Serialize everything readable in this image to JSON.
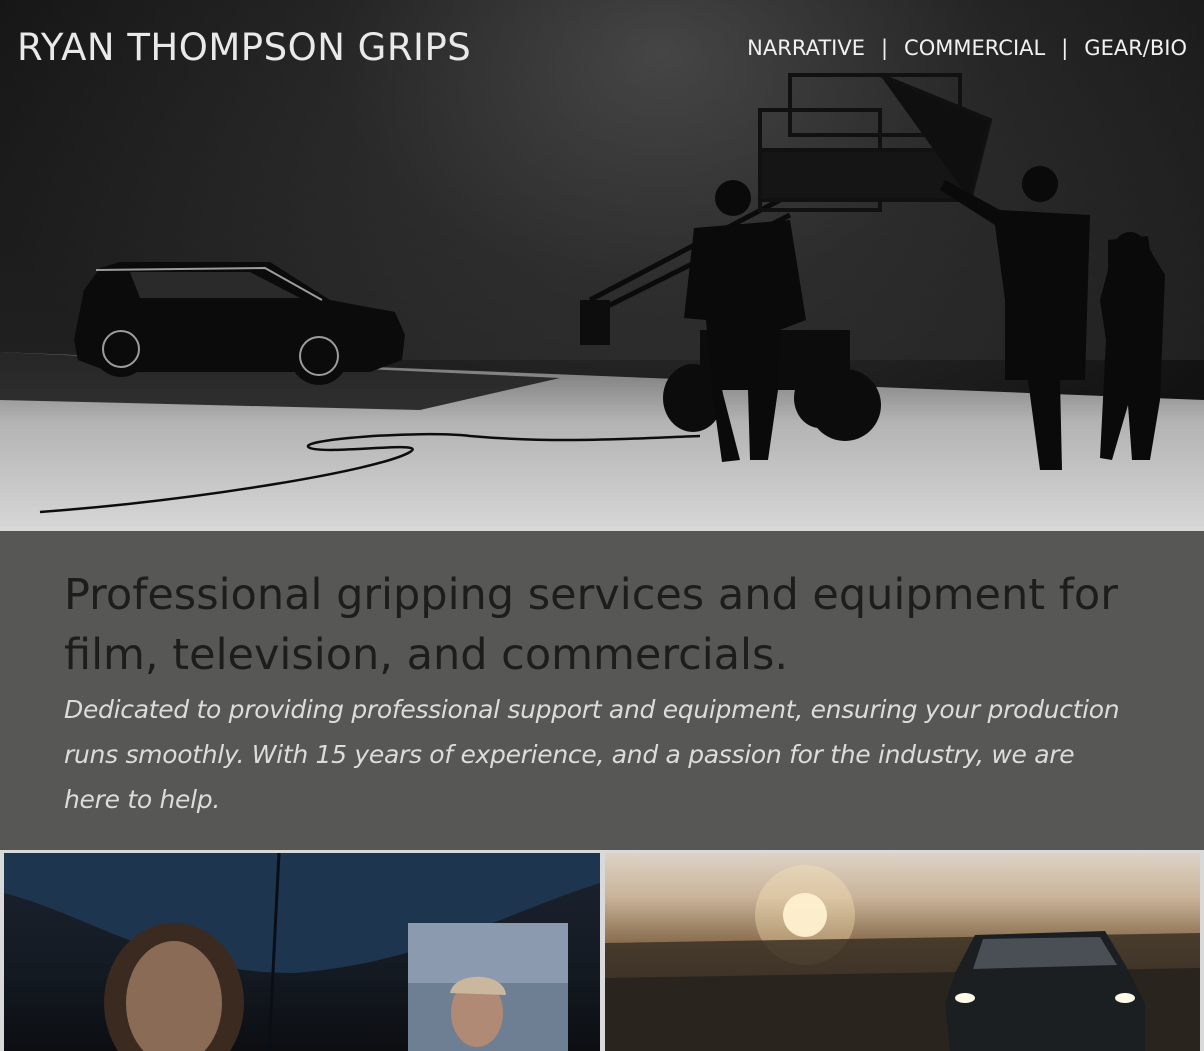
{
  "header": {
    "site_title": "RYAN THOMPSON GRIPS",
    "nav": [
      {
        "label": "NARRATIVE"
      },
      {
        "label": "COMMERCIAL"
      },
      {
        "label": "GEAR/BIO"
      }
    ],
    "nav_separator": "|"
  },
  "intro": {
    "headline": "Professional gripping services and equipment for film, television, and commercials.",
    "subtext": "Dedicated to providing professional support and equipment, ensuring your production runs smoothly. With 15 years of experience, and a passion for the industry, we are here to help."
  },
  "colors": {
    "intro_background": "#575756",
    "headline_text": "#1d1d1d",
    "subtext": "#dcdcdc",
    "nav_text": "#f1f1f1"
  }
}
